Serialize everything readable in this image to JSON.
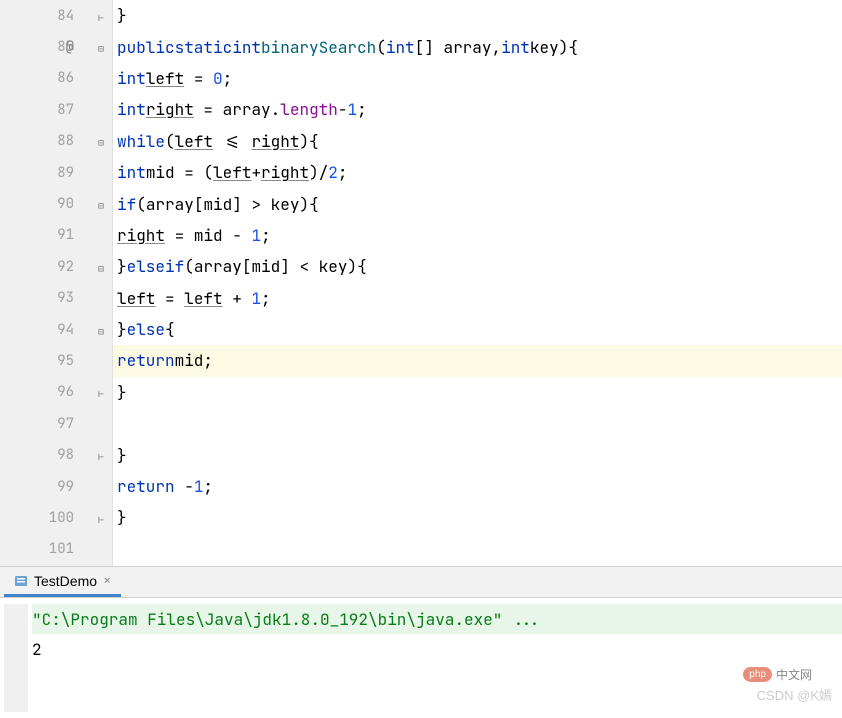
{
  "editor": {
    "gutter_annotation": "@",
    "lines": [
      {
        "num": "84",
        "fold": "close",
        "indent": 2,
        "tokens": [
          [
            "op",
            "}"
          ]
        ]
      },
      {
        "num": "85",
        "at": true,
        "fold": "open",
        "indent": 2,
        "tokens": [
          [
            "kw",
            "public"
          ],
          [
            "sp",
            " "
          ],
          [
            "kw",
            "static"
          ],
          [
            "sp",
            " "
          ],
          [
            "ty",
            "int"
          ],
          [
            "sp",
            " "
          ],
          [
            "mn",
            "binarySearch"
          ],
          [
            "op",
            "("
          ],
          [
            "ty",
            "int"
          ],
          [
            "op",
            "[] "
          ],
          [
            "vr",
            "array"
          ],
          [
            "op",
            ","
          ],
          [
            "ty",
            "int"
          ],
          [
            "sp",
            " "
          ],
          [
            "vr",
            "key"
          ],
          [
            "op",
            "){"
          ]
        ]
      },
      {
        "num": "86",
        "indent": 3,
        "tokens": [
          [
            "ty",
            "int"
          ],
          [
            "sp",
            " "
          ],
          [
            "vru",
            "left"
          ],
          [
            "sp",
            " = "
          ],
          [
            "nm",
            "0"
          ],
          [
            "op",
            ";"
          ]
        ]
      },
      {
        "num": "87",
        "indent": 3,
        "tokens": [
          [
            "ty",
            "int"
          ],
          [
            "sp",
            " "
          ],
          [
            "vru",
            "right"
          ],
          [
            "sp",
            " = "
          ],
          [
            "vr",
            "array"
          ],
          [
            "op",
            "."
          ],
          [
            "fld",
            "length"
          ],
          [
            "op",
            "-"
          ],
          [
            "nm",
            "1"
          ],
          [
            "op",
            ";"
          ]
        ]
      },
      {
        "num": "88",
        "fold": "open",
        "indent": 3,
        "tokens": [
          [
            "kw",
            "while"
          ],
          [
            "op",
            "("
          ],
          [
            "vru",
            "left"
          ],
          [
            "sp",
            " <= "
          ],
          [
            "vru",
            "right"
          ],
          [
            "op",
            "){"
          ]
        ]
      },
      {
        "num": "89",
        "indent": 4,
        "tokens": [
          [
            "ty",
            "int"
          ],
          [
            "sp",
            " "
          ],
          [
            "vr",
            "mid"
          ],
          [
            "sp",
            " = ("
          ],
          [
            "vru",
            "left"
          ],
          [
            "op",
            "+"
          ],
          [
            "vru",
            "right"
          ],
          [
            "op",
            ")/"
          ],
          [
            "nm",
            "2"
          ],
          [
            "op",
            ";"
          ]
        ]
      },
      {
        "num": "90",
        "fold": "open",
        "indent": 4,
        "tokens": [
          [
            "kw",
            "if"
          ],
          [
            "op",
            "("
          ],
          [
            "vr",
            "array"
          ],
          [
            "op",
            "["
          ],
          [
            "vr",
            "mid"
          ],
          [
            "op",
            "] > "
          ],
          [
            "vr",
            "key"
          ],
          [
            "op",
            "){"
          ]
        ]
      },
      {
        "num": "91",
        "indent": 5,
        "tokens": [
          [
            "vru",
            "right"
          ],
          [
            "sp",
            " = "
          ],
          [
            "vr",
            "mid"
          ],
          [
            "sp",
            " - "
          ],
          [
            "nm",
            "1"
          ],
          [
            "op",
            ";"
          ]
        ]
      },
      {
        "num": "92",
        "fold": "open",
        "indent": 4,
        "tokens": [
          [
            "op",
            "}"
          ],
          [
            "kw",
            "else"
          ],
          [
            "sp",
            " "
          ],
          [
            "kw",
            "if"
          ],
          [
            "op",
            "("
          ],
          [
            "vr",
            "array"
          ],
          [
            "op",
            "["
          ],
          [
            "vr",
            "mid"
          ],
          [
            "op",
            "] < "
          ],
          [
            "vr",
            "key"
          ],
          [
            "op",
            "){"
          ]
        ]
      },
      {
        "num": "93",
        "indent": 5,
        "tokens": [
          [
            "vru",
            "left"
          ],
          [
            "sp",
            " = "
          ],
          [
            "vru",
            "left"
          ],
          [
            "sp",
            " + "
          ],
          [
            "nm",
            "1"
          ],
          [
            "op",
            ";"
          ]
        ]
      },
      {
        "num": "94",
        "fold": "open",
        "indent": 4,
        "tokens": [
          [
            "op",
            "}"
          ],
          [
            "kw",
            "else"
          ],
          [
            "op",
            "{"
          ]
        ]
      },
      {
        "num": "95",
        "highlight": true,
        "indent": 5,
        "tokens": [
          [
            "kw",
            "return"
          ],
          [
            "sp",
            " "
          ],
          [
            "vr",
            "mid"
          ],
          [
            "op",
            ";"
          ]
        ]
      },
      {
        "num": "96",
        "fold": "close",
        "indent": 4,
        "tokens": [
          [
            "op",
            "}"
          ]
        ]
      },
      {
        "num": "97",
        "indent": 0,
        "tokens": []
      },
      {
        "num": "98",
        "fold": "close",
        "indent": 3,
        "tokens": [
          [
            "op",
            "}"
          ]
        ]
      },
      {
        "num": "99",
        "indent": 3,
        "tokens": [
          [
            "kw",
            "return"
          ],
          [
            "sp",
            " -"
          ],
          [
            "nm",
            "1"
          ],
          [
            "op",
            ";"
          ]
        ]
      },
      {
        "num": "100",
        "fold": "close",
        "indent": 2,
        "tokens": [
          [
            "op",
            "}"
          ]
        ]
      },
      {
        "num": "101",
        "indent": 0,
        "tokens": []
      }
    ]
  },
  "tabs": {
    "active": {
      "label": "TestDemo",
      "icon": "run-icon"
    }
  },
  "console": {
    "cmd": "\"C:\\Program Files\\Java\\jdk1.8.0_192\\bin\\java.exe\" ...",
    "output": "2"
  },
  "watermarks": {
    "php_badge": "php",
    "php_text": "中文网",
    "csdn": "CSDN @K嫣"
  }
}
